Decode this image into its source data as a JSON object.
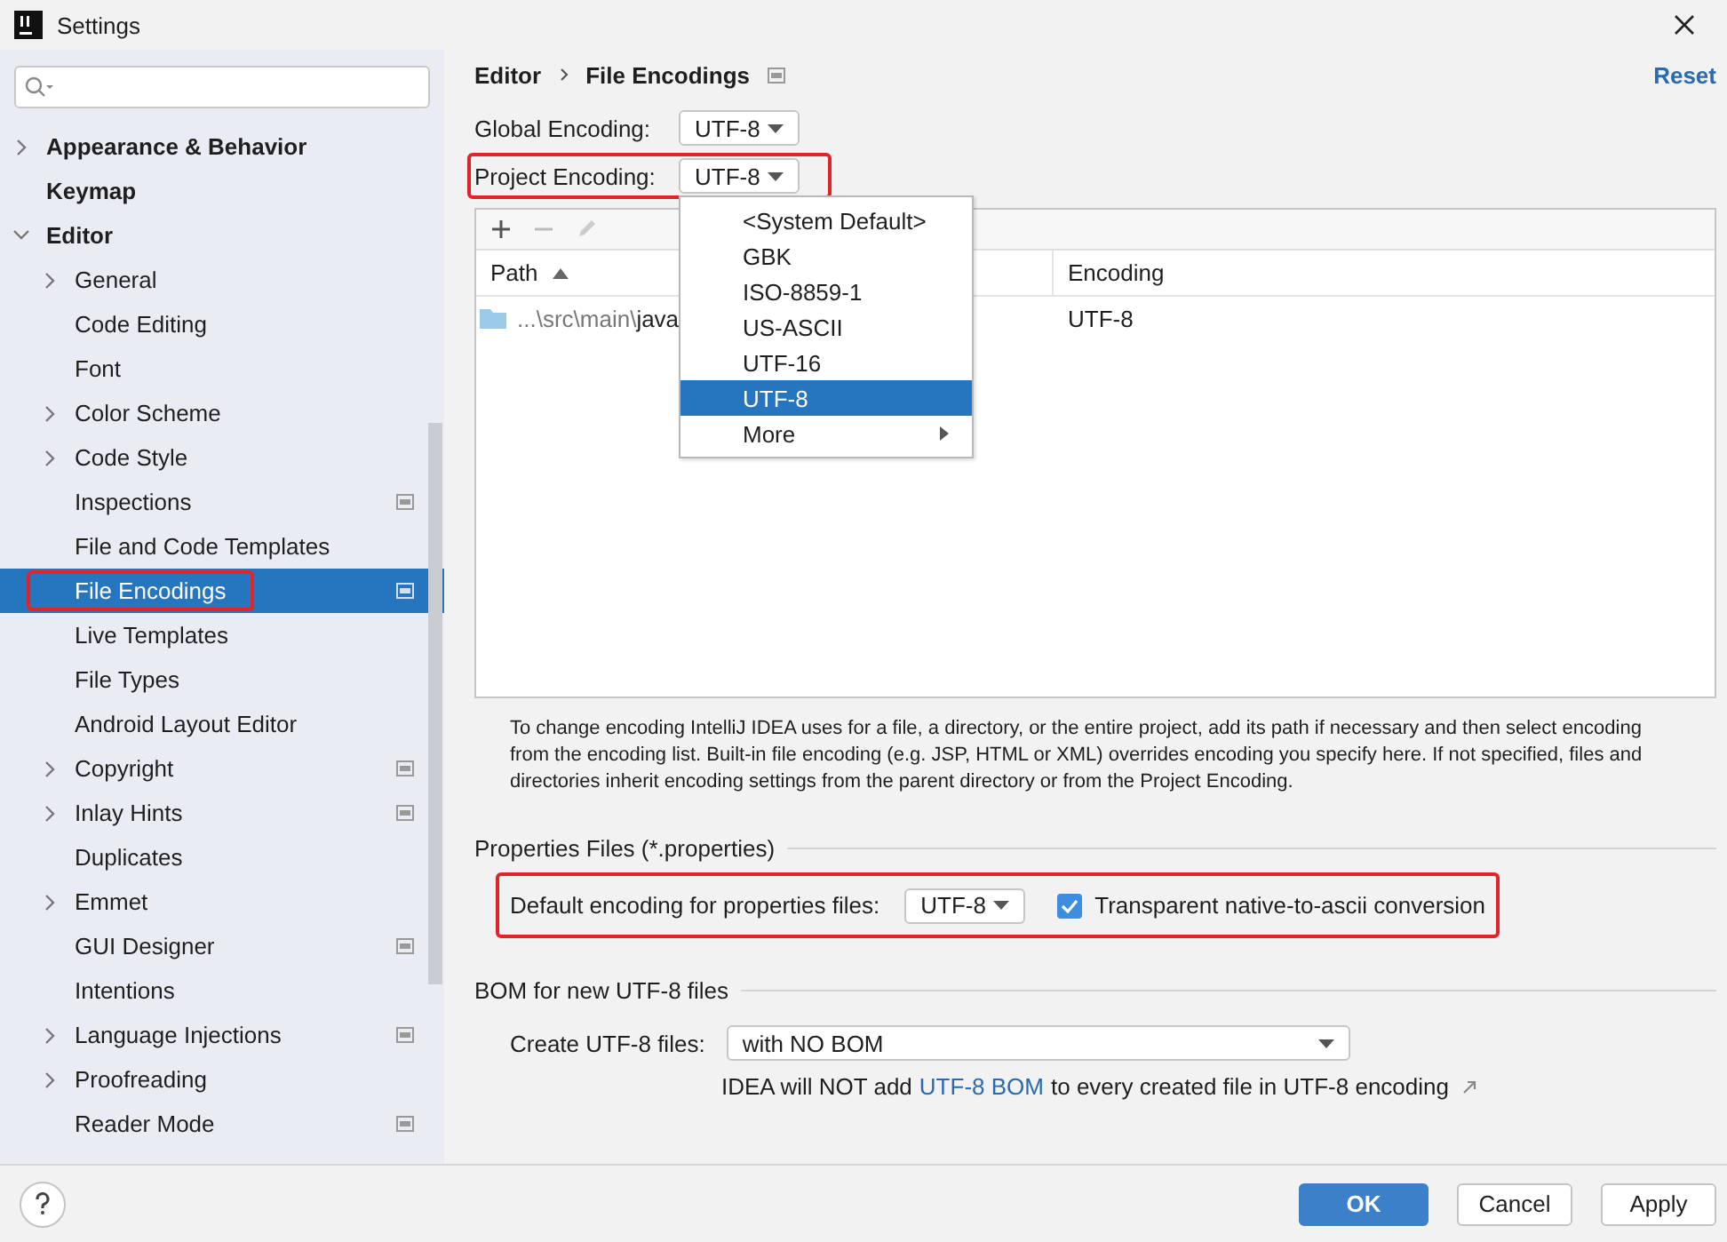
{
  "window": {
    "title": "Settings"
  },
  "sidebar": {
    "items": [
      {
        "label": "Appearance & Behavior",
        "kind": "group",
        "expanded": false,
        "selected": false,
        "project_icon": false,
        "highlighted": false
      },
      {
        "label": "Keymap",
        "kind": "leaf",
        "selected": false,
        "project_icon": false,
        "highlighted": false
      },
      {
        "label": "Editor",
        "kind": "group",
        "expanded": true,
        "selected": false,
        "project_icon": false,
        "highlighted": false,
        "children": [
          {
            "label": "General",
            "kind": "group",
            "expanded": false,
            "selected": false,
            "project_icon": false,
            "highlighted": false
          },
          {
            "label": "Code Editing",
            "kind": "leaf",
            "selected": false,
            "project_icon": false,
            "highlighted": false
          },
          {
            "label": "Font",
            "kind": "leaf",
            "selected": false,
            "project_icon": false,
            "highlighted": false
          },
          {
            "label": "Color Scheme",
            "kind": "group",
            "expanded": false,
            "selected": false,
            "project_icon": false,
            "highlighted": false
          },
          {
            "label": "Code Style",
            "kind": "group",
            "expanded": false,
            "selected": false,
            "project_icon": false,
            "highlighted": false
          },
          {
            "label": "Inspections",
            "kind": "leaf",
            "selected": false,
            "project_icon": true,
            "highlighted": false
          },
          {
            "label": "File and Code Templates",
            "kind": "leaf",
            "selected": false,
            "project_icon": false,
            "highlighted": false
          },
          {
            "label": "File Encodings",
            "kind": "leaf",
            "selected": true,
            "project_icon": true,
            "highlighted": true
          },
          {
            "label": "Live Templates",
            "kind": "leaf",
            "selected": false,
            "project_icon": false,
            "highlighted": false
          },
          {
            "label": "File Types",
            "kind": "leaf",
            "selected": false,
            "project_icon": false,
            "highlighted": false
          },
          {
            "label": "Android Layout Editor",
            "kind": "leaf",
            "selected": false,
            "project_icon": false,
            "highlighted": false
          },
          {
            "label": "Copyright",
            "kind": "group",
            "expanded": false,
            "selected": false,
            "project_icon": true,
            "highlighted": false
          },
          {
            "label": "Inlay Hints",
            "kind": "group",
            "expanded": false,
            "selected": false,
            "project_icon": true,
            "highlighted": false
          },
          {
            "label": "Duplicates",
            "kind": "leaf",
            "selected": false,
            "project_icon": false,
            "highlighted": false
          },
          {
            "label": "Emmet",
            "kind": "group",
            "expanded": false,
            "selected": false,
            "project_icon": false,
            "highlighted": false
          },
          {
            "label": "GUI Designer",
            "kind": "leaf",
            "selected": false,
            "project_icon": true,
            "highlighted": false
          },
          {
            "label": "Intentions",
            "kind": "leaf",
            "selected": false,
            "project_icon": false,
            "highlighted": false
          },
          {
            "label": "Language Injections",
            "kind": "group",
            "expanded": false,
            "selected": false,
            "project_icon": true,
            "highlighted": false
          },
          {
            "label": "Proofreading",
            "kind": "group",
            "expanded": false,
            "selected": false,
            "project_icon": false,
            "highlighted": false
          },
          {
            "label": "Reader Mode",
            "kind": "leaf",
            "selected": false,
            "project_icon": true,
            "highlighted": false
          }
        ]
      }
    ]
  },
  "breadcrumb": [
    "Editor",
    "File Encodings"
  ],
  "reset_link": "Reset",
  "global_encoding": {
    "label": "Global Encoding:",
    "value": "UTF-8"
  },
  "project_encoding": {
    "label": "Project Encoding:",
    "value": "UTF-8",
    "highlighted": true
  },
  "table": {
    "columns": [
      {
        "label": "Path",
        "sorted_ascending": true
      },
      {
        "label": "Encoding",
        "sorted_ascending": false
      }
    ],
    "rows": [
      {
        "path_prefix": "...\\src\\main\\",
        "path_name": "java",
        "encoding": "UTF-8"
      }
    ]
  },
  "encoding_popup": {
    "options": [
      {
        "label": "<System Default>",
        "selected": false,
        "submenu": false
      },
      {
        "label": "GBK",
        "selected": false,
        "submenu": false
      },
      {
        "label": "ISO-8859-1",
        "selected": false,
        "submenu": false
      },
      {
        "label": "US-ASCII",
        "selected": false,
        "submenu": false
      },
      {
        "label": "UTF-16",
        "selected": false,
        "submenu": false
      },
      {
        "label": "UTF-8",
        "selected": true,
        "submenu": false
      },
      {
        "label": "More",
        "selected": false,
        "submenu": true
      }
    ]
  },
  "description": "To change encoding IntelliJ IDEA uses for a file, a directory, or the entire project, add its path if necessary and then select encoding from the encoding list. Built-in file encoding (e.g. JSP, HTML or XML) overrides encoding you specify here. If not specified, files and directories inherit encoding settings from the parent directory or from the Project Encoding.",
  "properties_files": {
    "title": "Properties Files (*.properties)",
    "highlighted": true,
    "default_label": "Default encoding for properties files:",
    "default_value": "UTF-8",
    "native_to_ascii": {
      "label": "Transparent native-to-ascii conversion",
      "checked": true
    }
  },
  "bom": {
    "title": "BOM for new UTF-8 files",
    "create_label": "Create UTF-8 files:",
    "create_value": "with NO BOM",
    "note_before": "IDEA will NOT add ",
    "note_link": "UTF-8 BOM",
    "note_after": " to every created file in UTF-8 encoding"
  },
  "buttons": [
    {
      "label": "OK",
      "kind": "primary"
    },
    {
      "label": "Cancel",
      "kind": "normal"
    },
    {
      "label": "Apply",
      "kind": "normal"
    }
  ]
}
